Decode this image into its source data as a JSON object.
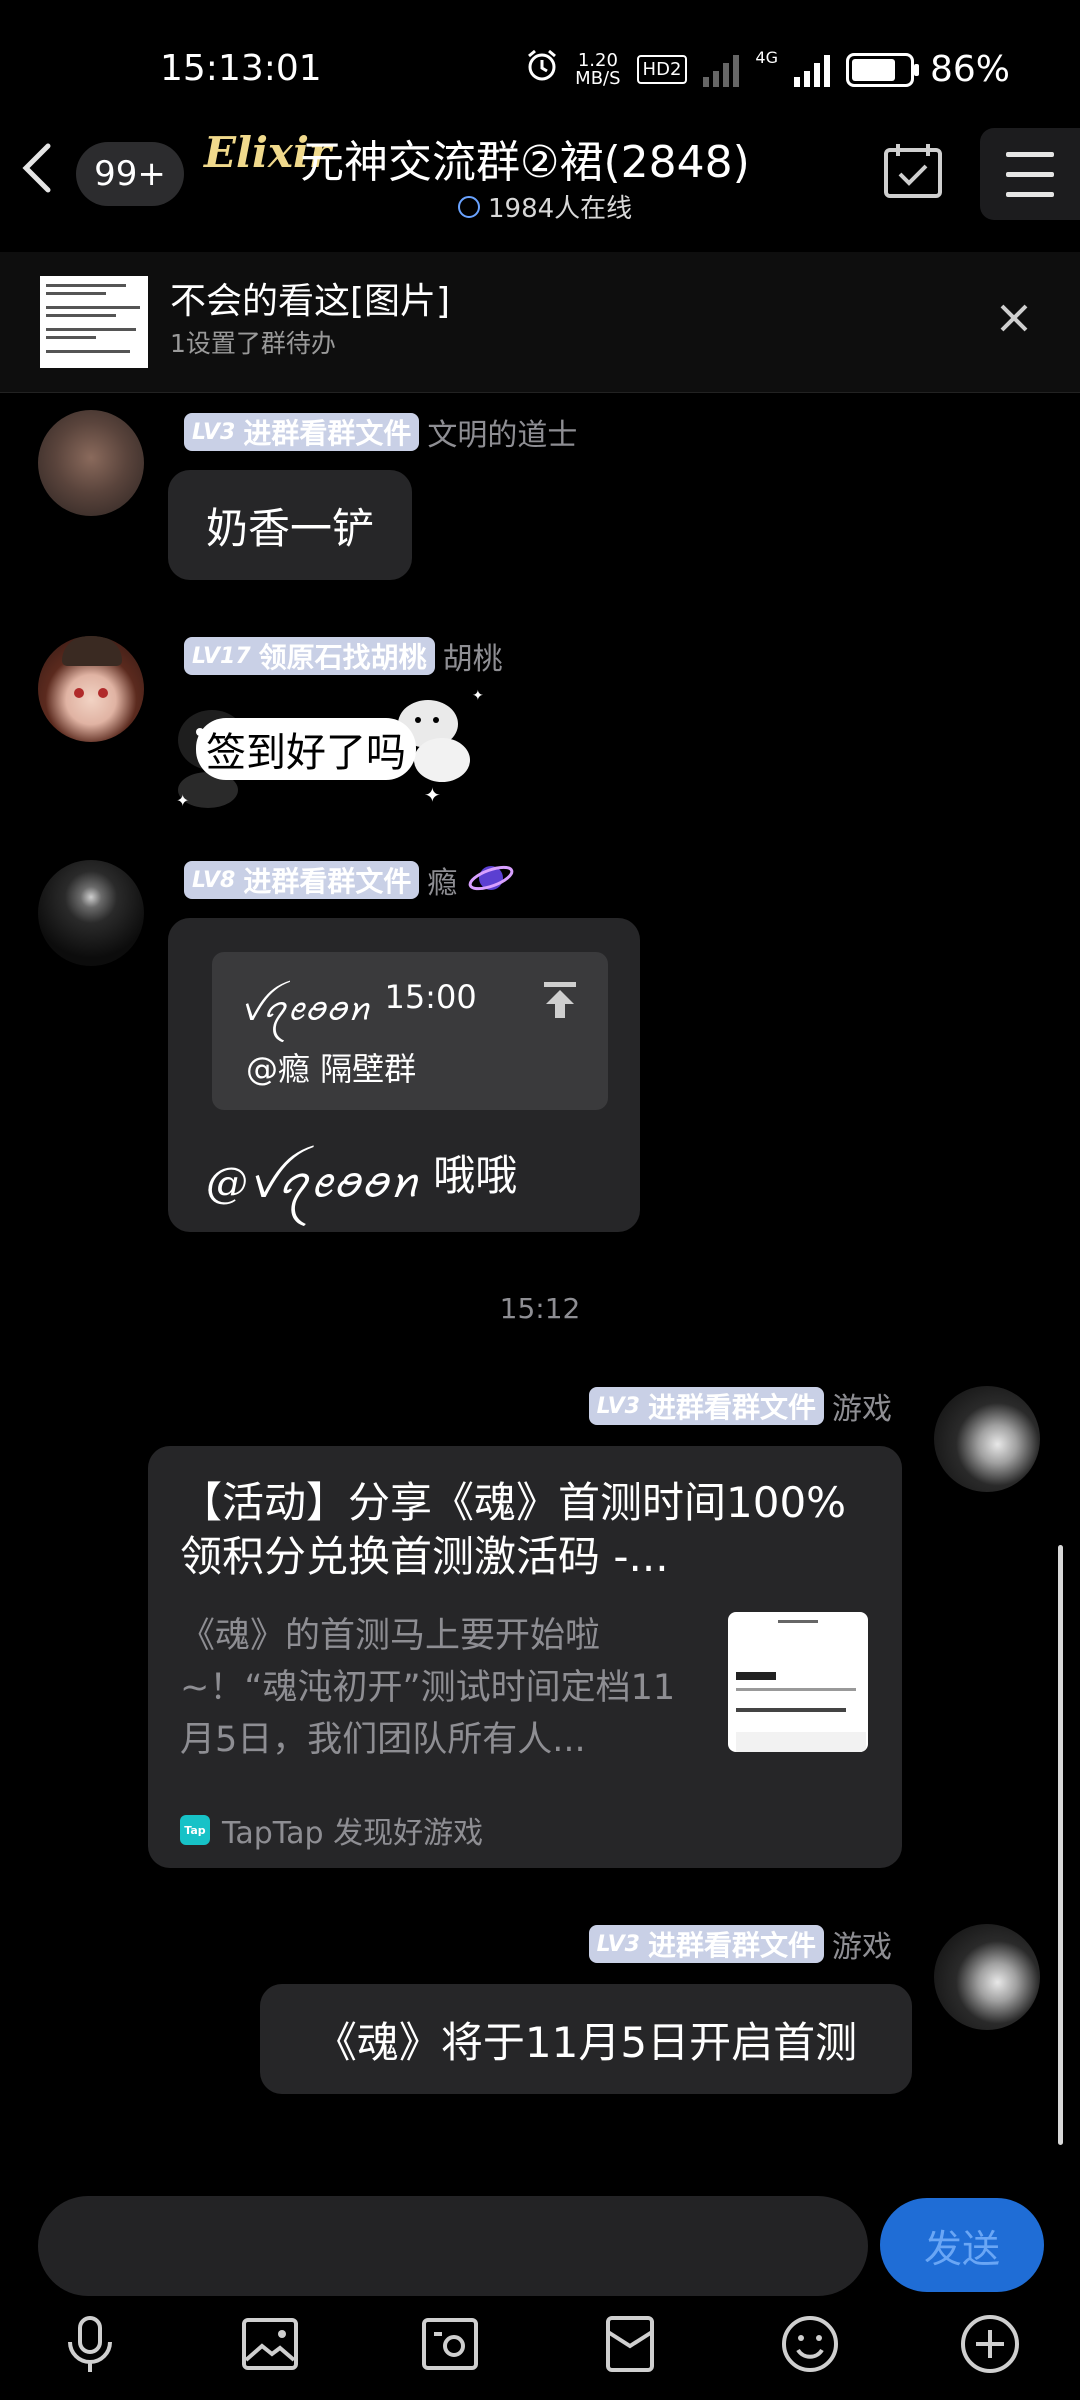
{
  "status_bar": {
    "time": "15:13:01",
    "net_speed_value": "1.20",
    "net_speed_unit": "MB/S",
    "hd_label": "HD2",
    "network_type": "4G",
    "battery_percent": "86%",
    "battery_level": 0.86
  },
  "header": {
    "unread_count": "99+",
    "logo_text": "Elixir",
    "group_name": "元神交流群②裙(2848)",
    "online_text": "1984人在线"
  },
  "pinned": {
    "title": "不会的看这[图片]",
    "subtitle": "1设置了群待办"
  },
  "messages": [
    {
      "badge_level": "LV3",
      "badge_title": "进群看群文件",
      "nickname": "文明的道士",
      "text": "奶香一铲",
      "badge_color": "#c9d0e6"
    },
    {
      "badge_level": "LV17",
      "badge_title": "领原石找胡桃",
      "nickname": "胡桃",
      "text": "签到好了吗",
      "badge_color": "#c9d0e6"
    },
    {
      "badge_level": "LV8",
      "badge_title": "进群看群文件",
      "nickname": "瘾",
      "quote_author": "ꪜꪖꫀꪮꪮꪀ",
      "quote_time": "15:00",
      "quote_text": "@瘾 隔壁群",
      "reply_mention": "@ꪜꪖꫀꪮꪮꪀ",
      "reply_text": "哦哦"
    }
  ],
  "timestamp": "15:12",
  "outgoing": [
    {
      "badge_level": "LV3",
      "badge_title": "进群看群文件",
      "nickname": "游戏",
      "card_title": "【活动】分享《魂》首测时间100%领积分兑换首测激活码 -...",
      "card_desc": "《魂》的首测马上要开始啦~！“魂沌初开”测试时间定档11月5日，我们团队所有人...",
      "card_source_icon": "Tap",
      "card_source": "TapTap 发现好游戏"
    },
    {
      "badge_level": "LV3",
      "badge_title": "进群看群文件",
      "nickname": "游戏",
      "text": "《魂》将于11月5日开启首测"
    }
  ],
  "input": {
    "send_label": "发送"
  },
  "toolbar": [
    "microphone-icon",
    "image-icon",
    "camera-icon",
    "red-packet-icon",
    "emoji-icon",
    "plus-icon"
  ]
}
